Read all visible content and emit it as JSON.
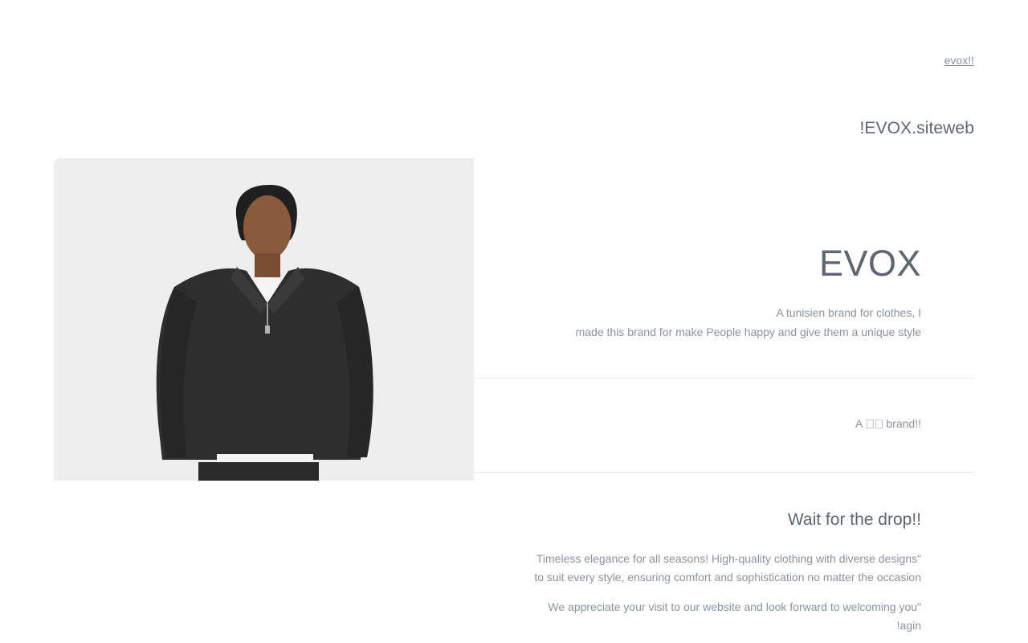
{
  "nav": {
    "top_link": "evox!!"
  },
  "header": {
    "site_title": "!EVOX.siteweb"
  },
  "hero": {
    "image_alt": "Model wearing a dark half-zip sweatshirt",
    "heading": "EVOX",
    "description_line1": "A tunisien brand for clothes, I",
    "description_line2": "made this brand for make People happy and give them a unique style"
  },
  "tagline": {
    "prefix": "A",
    "suffix": "brand!!"
  },
  "drop": {
    "heading": "Wait for the drop!!",
    "para1_line1": "Timeless elegance for all seasons! High-quality clothing with diverse designs\"",
    "para1_line2": "to suit every style, ensuring comfort and sophistication no matter the occasion",
    "para2_line1": "We appreciate your visit to our website and look forward to welcoming you\"",
    "para2_line2": "!agin"
  },
  "colors": {
    "heading": "#5f6670",
    "body_text": "#8d939b",
    "divider": "#e6e6e6",
    "background": "#ffffff"
  }
}
